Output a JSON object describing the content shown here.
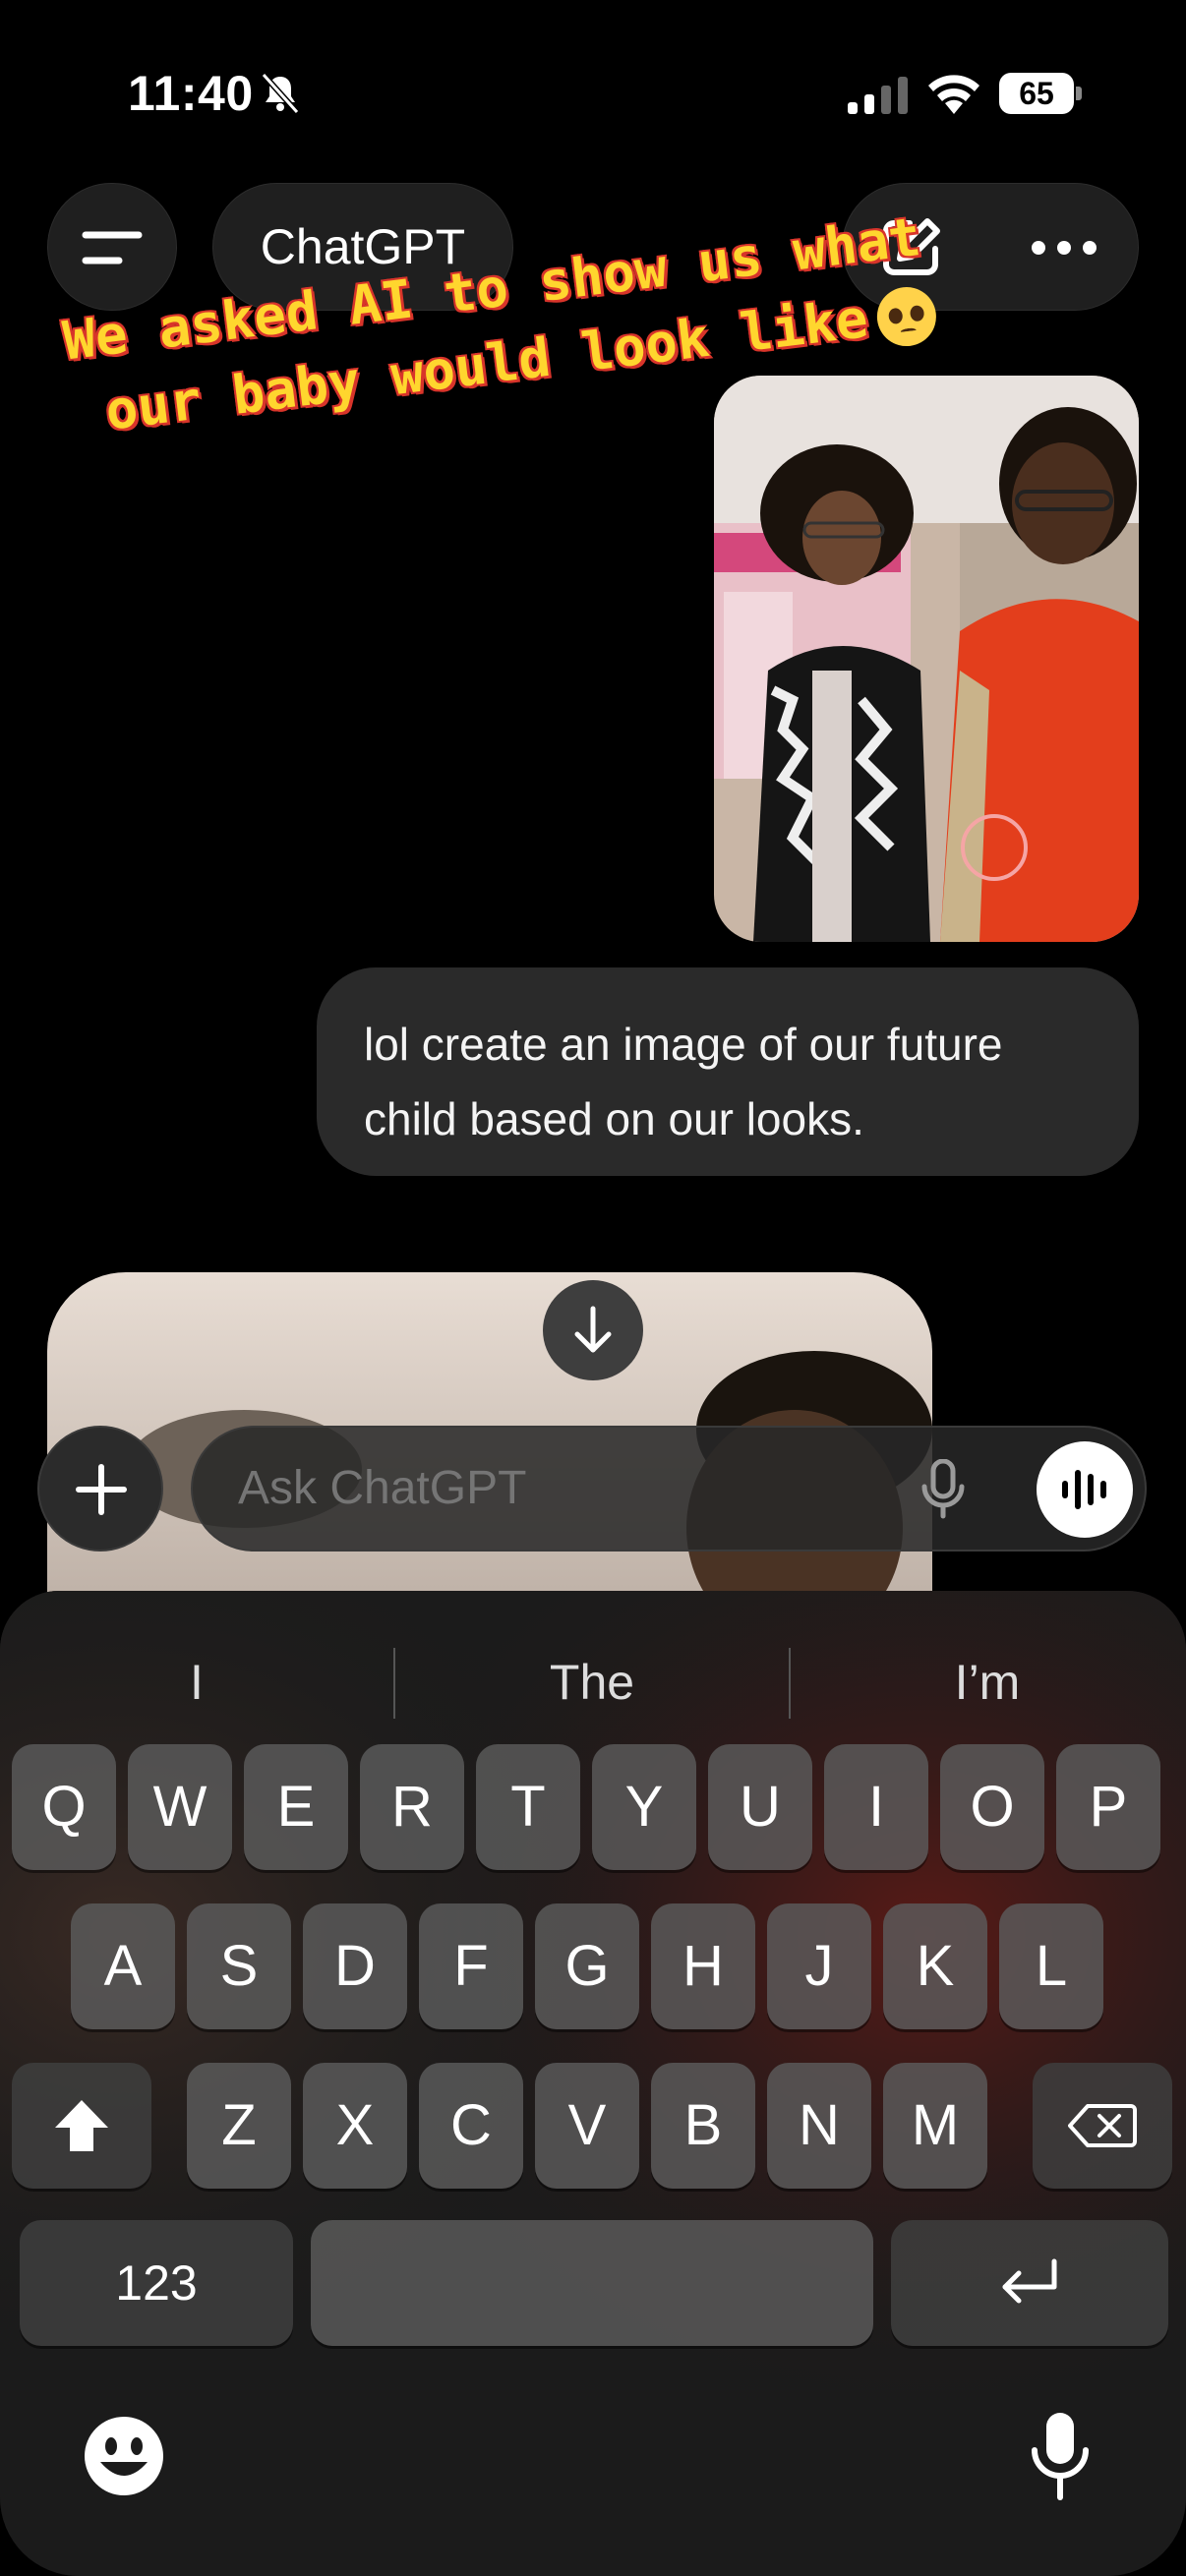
{
  "status_bar": {
    "time": "11:40",
    "battery": "65"
  },
  "header": {
    "title": "ChatGPT"
  },
  "caption": {
    "line1": "We asked AI to show us what",
    "line2": "our baby would look like"
  },
  "messages": [
    {
      "role": "user",
      "text": "lol create an image of our future child based on our looks."
    }
  ],
  "composer": {
    "placeholder": "Ask ChatGPT"
  },
  "keyboard": {
    "suggestions": [
      "I",
      "The",
      "I’m"
    ],
    "rows": [
      [
        "Q",
        "W",
        "E",
        "R",
        "T",
        "Y",
        "U",
        "I",
        "O",
        "P"
      ],
      [
        "A",
        "S",
        "D",
        "F",
        "G",
        "H",
        "J",
        "K",
        "L"
      ],
      [
        "Z",
        "X",
        "C",
        "V",
        "B",
        "N",
        "M"
      ]
    ],
    "numbers_key": "123"
  },
  "icons": {
    "status": [
      "bell-slash-icon",
      "signal-icon",
      "wifi-icon",
      "battery-icon"
    ],
    "header": [
      "menu-icon",
      "compose-icon",
      "more-icon"
    ],
    "composer": [
      "plus-icon",
      "microphone-icon",
      "voice-mode-icon",
      "arrow-down-icon"
    ],
    "keyboard": [
      "shift-icon",
      "backspace-icon",
      "return-icon",
      "emoji-icon",
      "dictation-icon"
    ]
  },
  "colors": {
    "background": "#000000",
    "bubble": "#2a2a2a",
    "caption_text": "#ffd62e",
    "caption_outline": "#d8342a"
  }
}
